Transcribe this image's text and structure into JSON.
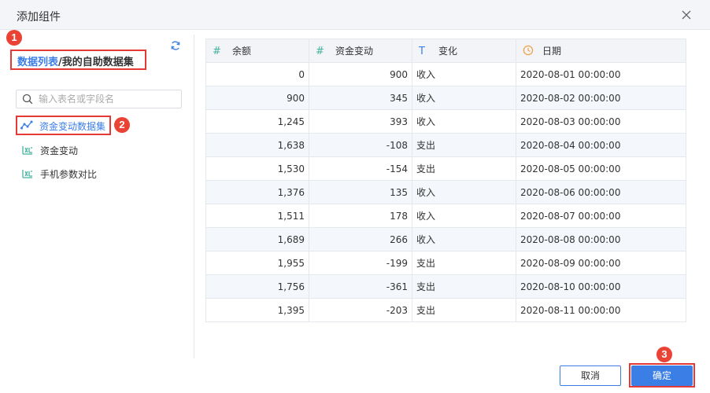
{
  "dialog": {
    "title": "添加组件",
    "close_icon": "close-icon"
  },
  "annotations": [
    "1",
    "2",
    "3"
  ],
  "breadcrumb": {
    "link": "数据列表",
    "sep": "/",
    "current": "我的自助数据集"
  },
  "search": {
    "placeholder": "输入表名或字段名",
    "value": ""
  },
  "datasets": [
    {
      "label": "资金变动数据集",
      "icon": "trend-icon",
      "active": true
    },
    {
      "label": "资金变动",
      "icon": "table-icon",
      "active": false
    },
    {
      "label": "手机参数对比",
      "icon": "table-icon",
      "active": false
    }
  ],
  "table": {
    "columns": [
      {
        "label": "余额",
        "type_icon": "#"
      },
      {
        "label": "资金变动",
        "type_icon": "#"
      },
      {
        "label": "变化",
        "type_icon": "T"
      },
      {
        "label": "日期",
        "type_icon": "clock-icon"
      }
    ],
    "rows": [
      [
        "0",
        "900",
        "收入",
        "2020-08-01 00:00:00"
      ],
      [
        "900",
        "345",
        "收入",
        "2020-08-02 00:00:00"
      ],
      [
        "1,245",
        "393",
        "收入",
        "2020-08-03 00:00:00"
      ],
      [
        "1,638",
        "-108",
        "支出",
        "2020-08-04 00:00:00"
      ],
      [
        "1,530",
        "-154",
        "支出",
        "2020-08-05 00:00:00"
      ],
      [
        "1,376",
        "135",
        "收入",
        "2020-08-06 00:00:00"
      ],
      [
        "1,511",
        "178",
        "收入",
        "2020-08-07 00:00:00"
      ],
      [
        "1,689",
        "266",
        "收入",
        "2020-08-08 00:00:00"
      ],
      [
        "1,955",
        "-199",
        "支出",
        "2020-08-09 00:00:00"
      ],
      [
        "1,756",
        "-361",
        "支出",
        "2020-08-10 00:00:00"
      ],
      [
        "1,395",
        "-203",
        "支出",
        "2020-08-11 00:00:00"
      ]
    ]
  },
  "footer": {
    "cancel_label": "取消",
    "ok_label": "确定"
  },
  "colors": {
    "accent": "#3a7ee6",
    "highlight": "#e53935",
    "numeric_icon": "#45b39d",
    "date_icon": "#f0a24b"
  }
}
